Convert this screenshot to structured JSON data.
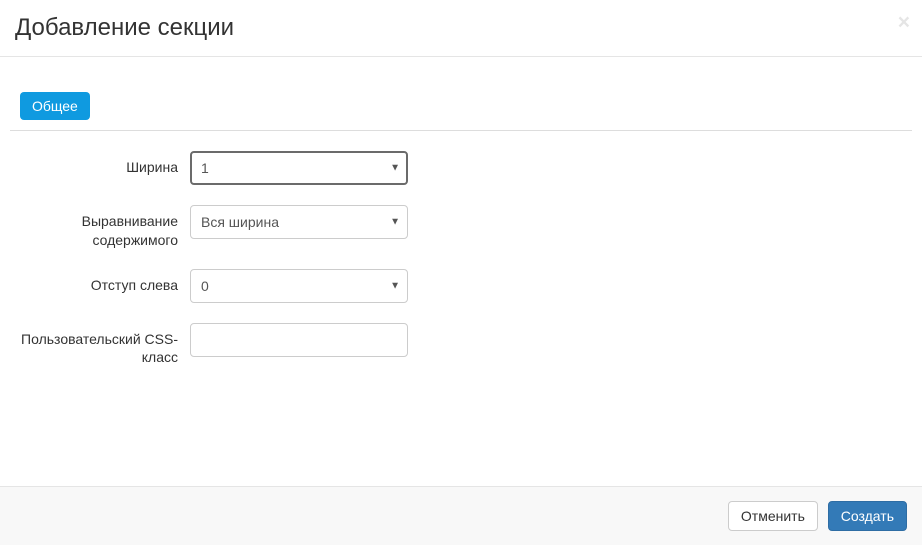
{
  "header": {
    "title": "Добавление секции",
    "close_glyph": "×"
  },
  "tabs": {
    "general": "Общее"
  },
  "form": {
    "width": {
      "label": "Ширина",
      "value": "1"
    },
    "align": {
      "label": "Выравнивание содержимого",
      "value": "Вся ширина"
    },
    "offset": {
      "label": "Отступ слева",
      "value": "0"
    },
    "css_class": {
      "label": "Пользовательский CSS-класс",
      "value": ""
    }
  },
  "footer": {
    "cancel": "Отменить",
    "create": "Создать"
  }
}
